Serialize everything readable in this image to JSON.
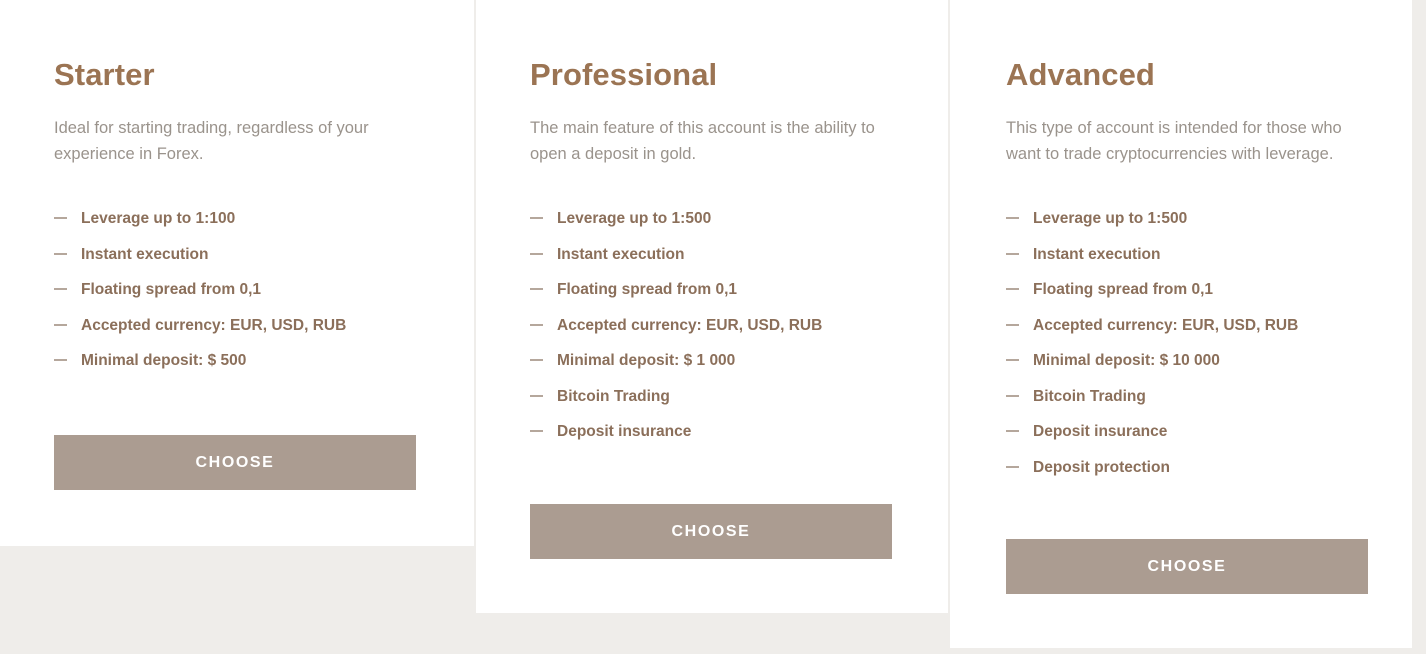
{
  "page": {
    "background_color": "#efedea",
    "card_background_color": "#ffffff",
    "title_color": "#9b7453",
    "description_color": "#9a938c",
    "feature_color": "#8b6f5a",
    "dash_color": "#b5a79c",
    "button_color": "#ab9c91",
    "button_text_color": "#ffffff"
  },
  "plans": [
    {
      "id": "starter",
      "title": "Starter",
      "description": "Ideal for starting trading, regardless of your experience in Forex.",
      "features": [
        "Leverage up to 1:100",
        "Instant execution",
        "Floating spread from 0,1",
        "Accepted currency: EUR, USD, RUB",
        "Minimal deposit: $ 500"
      ],
      "button_label": "CHOOSE"
    },
    {
      "id": "professional",
      "title": "Professional",
      "description": "The main feature of this account is the ability to open a deposit in gold.",
      "features": [
        "Leverage up to 1:500",
        "Instant execution",
        "Floating spread from 0,1",
        "Accepted currency: EUR, USD, RUB",
        "Minimal deposit: $ 1 000",
        "Bitcoin Trading",
        "Deposit insurance"
      ],
      "button_label": "CHOOSE"
    },
    {
      "id": "advanced",
      "title": "Advanced",
      "description": "This type of account is intended for those who want to trade cryptocurrencies with leverage.",
      "features": [
        "Leverage up to 1:500",
        "Instant execution",
        "Floating spread from 0,1",
        "Accepted currency: EUR, USD, RUB",
        "Minimal deposit: $ 10 000",
        "Bitcoin Trading",
        "Deposit insurance",
        "Deposit protection"
      ],
      "button_label": "CHOOSE"
    }
  ]
}
